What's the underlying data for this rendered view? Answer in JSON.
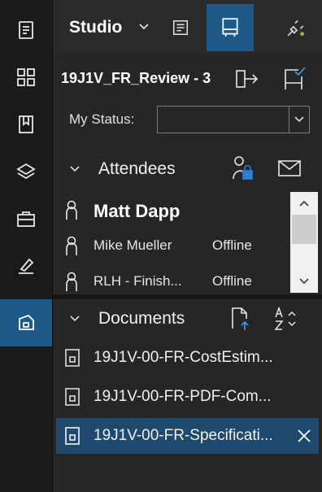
{
  "rail": {
    "items": [
      {
        "icon": "document-list-icon",
        "active": false
      },
      {
        "icon": "grid-icon",
        "active": false
      },
      {
        "icon": "bookmark-icon",
        "active": false
      },
      {
        "icon": "layers-icon",
        "active": false
      },
      {
        "icon": "toolbox-icon",
        "active": false
      },
      {
        "icon": "signature-icon",
        "active": false
      },
      {
        "icon": "studio-icon",
        "active": true
      }
    ]
  },
  "header": {
    "title": "Studio",
    "buttons": [
      {
        "icon": "document-text-icon",
        "active": false
      },
      {
        "icon": "layout-panel-icon",
        "active": true
      },
      {
        "icon": "disconnect-plug-icon",
        "active": false
      }
    ]
  },
  "session": {
    "name": "19J1V_FR_Review - 3",
    "leave_icon": "exit-session-icon",
    "checkin_icon": "checkin-icon"
  },
  "status": {
    "label": "My Status:",
    "value": ""
  },
  "attendees": {
    "title": "Attendees",
    "lock_icon": "person-lock-icon",
    "mail_icon": "envelope-icon",
    "rows": [
      {
        "name": "Matt Dapp",
        "status": "",
        "is_self": true
      },
      {
        "name": "Mike Mueller",
        "status": "Offline",
        "is_self": false
      },
      {
        "name": "RLH - Finish...",
        "status": "Offline",
        "is_self": false
      }
    ]
  },
  "documents": {
    "title": "Documents",
    "upload_icon": "upload-document-icon",
    "sort_icon": "sort-az-icon",
    "items": [
      {
        "name": "19J1V-00-FR-CostEstim...",
        "selected": false
      },
      {
        "name": "19J1V-00-FR-PDF-Com...",
        "selected": false
      },
      {
        "name": "19J1V-00-FR-Specificati...",
        "selected": true
      }
    ]
  },
  "colors": {
    "accent": "#1d5a8a",
    "selected_row": "#1f4a6e",
    "panel_bg": "#262626",
    "rail_bg": "#1b1b1b",
    "lock_badge": "#2f7fd0",
    "upload_arrow": "#3b9cf0"
  }
}
